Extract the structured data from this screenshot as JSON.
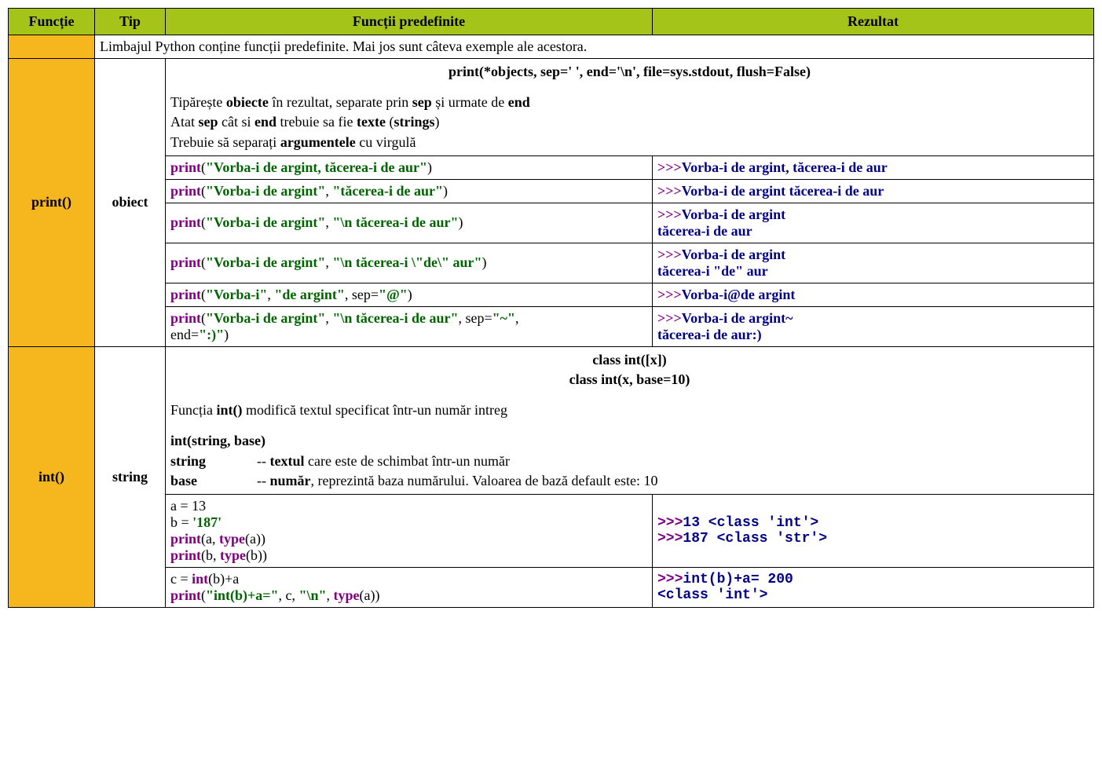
{
  "headers": {
    "h1": "Funcție",
    "h2": "Tip",
    "h3": "Funcții predefinite",
    "h4": "Rezultat"
  },
  "intro": "Limbajul Python conține funcții predefinite. Mai jos sunt câteva exemple ale acestora.",
  "print_section": {
    "func": "print()",
    "type": "obiect",
    "signature": "print(*objects, sep=' ', end='\\n', file=sys.stdout, flush=False)",
    "desc_l1_a": "Tipărește ",
    "desc_l1_b": "obiecte",
    "desc_l1_c": " în rezultat, separate prin ",
    "desc_l1_d": "sep",
    "desc_l1_e": " și urmate de ",
    "desc_l1_f": "end",
    "desc_l2_a": "Atat ",
    "desc_l2_b": "sep",
    "desc_l2_c": " cât si ",
    "desc_l2_d": "end",
    "desc_l2_e": " trebuie sa fie ",
    "desc_l2_f": "texte",
    "desc_l2_g": " (",
    "desc_l2_h": "strings",
    "desc_l2_i": ")",
    "desc_l3_a": "Trebuie să separați ",
    "desc_l3_b": "argumentele",
    "desc_l3_c": " cu virgulă",
    "r1_f": "print",
    "r1_s": "\"Vorba-i de argint, tăcerea-i de aur\"",
    "r1_res_p": ">>>",
    "r1_res_t": "Vorba-i de argint, tăcerea-i de aur",
    "r2_f": "print",
    "r2_s1": "\"Vorba-i de argint\"",
    "r2_s2": "\"tăcerea-i de aur\"",
    "r2_res_p": ">>>",
    "r2_res_t": "Vorba-i de argint tăcerea-i de aur",
    "r3_f": "print",
    "r3_s1": "\"Vorba-i de argint\"",
    "r3_s2": "\"\\n tăcerea-i de aur\"",
    "r3_res_p": ">>>",
    "r3_res_l1": "Vorba-i de argint",
    "r3_res_l2": " tăcerea-i de aur",
    "r4_f": "print",
    "r4_s1": "\"Vorba-i de argint\"",
    "r4_s2": "\"\\n tăcerea-i \\\"de\\\" aur\"",
    "r4_res_p": ">>>",
    "r4_res_l1": "Vorba-i de argint",
    "r4_res_l2": " tăcerea-i \"de\" aur",
    "r5_f": "print",
    "r5_s1": "\"Vorba-i\"",
    "r5_s2": "\"de argint\"",
    "r5_kw": "sep=",
    "r5_kv": "\"@\"",
    "r5_res_p": ">>>",
    "r5_res_t": "Vorba-i@de argint",
    "r6_f": "print",
    "r6_s1": "\"Vorba-i de argint\"",
    "r6_s2": "\"\\n tăcerea-i de aur\"",
    "r6_kw1": " sep=",
    "r6_kv1": "\"~\"",
    "r6_cm": ", ",
    "r6_kw2": "end=",
    "r6_kv2": "\":)\"",
    "r6_res_p": ">>>",
    "r6_res_l1": "Vorba-i de argint~",
    "r6_res_l2": " tăcerea-i de aur:)"
  },
  "int_section": {
    "func": "int()",
    "type": "string",
    "sig1": "class int([x])",
    "sig2": "class int(x, base=10)",
    "d1_a": "Funcția ",
    "d1_b": "int()",
    "d1_c": " modifică textul specificat într-un număr intreg",
    "d2": "int(string, base)",
    "d3_a": "string",
    "d3_b": "--  ",
    "d3_c": "textul",
    "d3_d": " care este de schimbat într-un număr",
    "d4_a": "base",
    "d4_b": "--  ",
    "d4_c": "număr",
    "d4_d": ", reprezintă baza numărului. Valoarea de bază default este: 10",
    "r1_l1": "a = 13",
    "r1_l2_a": "b = ",
    "r1_l2_b": "'187'",
    "r1_l3_f": "print",
    "r1_l3_mid": "(a, ",
    "r1_l3_t": "type",
    "r1_l3_end": "(a))",
    "r1_l4_f": "print",
    "r1_l4_mid": "(b, ",
    "r1_l4_t": "type",
    "r1_l4_end": "(b))",
    "r1_res_p1": ">>>",
    "r1_res_t1": "13 <class 'int'>",
    "r1_res_p2": ">>>",
    "r1_res_t2": "187 <class 'str'>",
    "r2_l1_a": "c = ",
    "r2_l1_b": "int",
    "r2_l1_c": "(b)+a",
    "r2_l2_f": "print",
    "r2_l2_s1": "\"int(b)+a=\"",
    "r2_l2_m1": ", c, ",
    "r2_l2_s2": "\"\\n\"",
    "r2_l2_m2": ", ",
    "r2_l2_t": "type",
    "r2_l2_end": "(a))",
    "r2_res_p": ">>>",
    "r2_res_l1": "int(b)+a= 200",
    "r2_res_l2": " <class 'int'>"
  },
  "sep_comma": ", ",
  "paren_open": "(",
  "paren_close": ")"
}
